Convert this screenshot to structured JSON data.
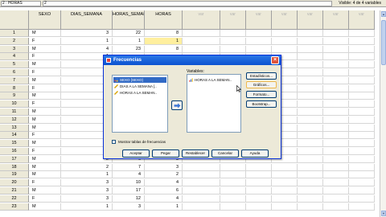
{
  "toolbar": {
    "cell_ref": "2 : HORAS",
    "cell_value": "2",
    "visible_text": "Visible: 4 de 4 variables"
  },
  "columns": [
    "SEXO",
    "DIAS_SEMANA",
    "HORAS_SEMANA",
    "HORAS",
    "var",
    "var",
    "var",
    "var",
    "var",
    "var",
    "var"
  ],
  "rows": [
    {
      "n": "1",
      "sexo": "M",
      "dias": "3",
      "hsem": "22",
      "horas": "8"
    },
    {
      "n": "2",
      "sexo": "F",
      "dias": "1",
      "hsem": "1",
      "horas": "1"
    },
    {
      "n": "3",
      "sexo": "M",
      "dias": "4",
      "hsem": "23",
      "horas": "8"
    },
    {
      "n": "4",
      "sexo": "F",
      "dias": "1",
      "hsem": "",
      "horas": ""
    },
    {
      "n": "5",
      "sexo": "M",
      "dias": "1",
      "hsem": "",
      "horas": ""
    },
    {
      "n": "6",
      "sexo": "F",
      "dias": "1",
      "hsem": "",
      "horas": ""
    },
    {
      "n": "7",
      "sexo": "M",
      "dias": "2",
      "hsem": "",
      "horas": ""
    },
    {
      "n": "8",
      "sexo": "F",
      "dias": "3",
      "hsem": "",
      "horas": ""
    },
    {
      "n": "9",
      "sexo": "M",
      "dias": "2",
      "hsem": "",
      "horas": ""
    },
    {
      "n": "10",
      "sexo": "F",
      "dias": "2",
      "hsem": "",
      "horas": ""
    },
    {
      "n": "11",
      "sexo": "M",
      "dias": "3",
      "hsem": "",
      "horas": ""
    },
    {
      "n": "12",
      "sexo": "M",
      "dias": "2",
      "hsem": "",
      "horas": ""
    },
    {
      "n": "13",
      "sexo": "M",
      "dias": "3",
      "hsem": "",
      "horas": ""
    },
    {
      "n": "14",
      "sexo": "F",
      "dias": "3",
      "hsem": "",
      "horas": ""
    },
    {
      "n": "15",
      "sexo": "M",
      "dias": "2",
      "hsem": "",
      "horas": ""
    },
    {
      "n": "16",
      "sexo": "F",
      "dias": "3",
      "hsem": "",
      "horas": ""
    },
    {
      "n": "17",
      "sexo": "M",
      "dias": "2",
      "hsem": "6",
      "horas": "3"
    },
    {
      "n": "18",
      "sexo": "M",
      "dias": "2",
      "hsem": "7",
      "horas": "3"
    },
    {
      "n": "19",
      "sexo": "M",
      "dias": "1",
      "hsem": "4",
      "horas": "2"
    },
    {
      "n": "20",
      "sexo": "F",
      "dias": "3",
      "hsem": "10",
      "horas": "4"
    },
    {
      "n": "21",
      "sexo": "M",
      "dias": "3",
      "hsem": "17",
      "horas": "6"
    },
    {
      "n": "22",
      "sexo": "F",
      "dias": "3",
      "hsem": "12",
      "horas": "4"
    },
    {
      "n": "23",
      "sexo": "M",
      "dias": "1",
      "hsem": "3",
      "horas": "1"
    }
  ],
  "dialog": {
    "title": "Frecuencias",
    "variables_label": "Variables:",
    "source_items": [
      "SEXO [SEXO]",
      "DIAS A LA SEMANA [..",
      "HORAS A LA SEMAN.."
    ],
    "selected_items": [
      "HORAS A LA SEMAN.."
    ],
    "side_buttons": [
      "Estadísticos...",
      "Gráficos...",
      "Formato...",
      "Bootstrap..."
    ],
    "checkbox_label": "Mostrar tablas de frecuencias",
    "bottom_buttons": [
      "Aceptar",
      "Pegar",
      "Restablecer",
      "Cancelar",
      "Ayuda"
    ],
    "close_glyph": "×"
  }
}
